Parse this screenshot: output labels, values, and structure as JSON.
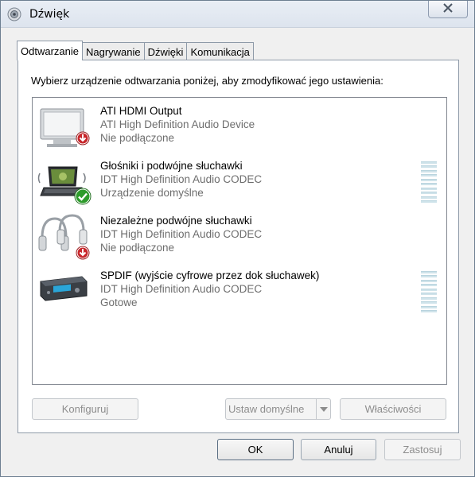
{
  "window": {
    "title": "Dźwięk"
  },
  "tabs": [
    {
      "label": "Odtwarzanie"
    },
    {
      "label": "Nagrywanie"
    },
    {
      "label": "Dźwięki"
    },
    {
      "label": "Komunikacja"
    }
  ],
  "instruction": "Wybierz urządzenie odtwarzania poniżej, aby zmodyfikować jego ustawienia:",
  "devices": [
    {
      "name": "ATI HDMI Output",
      "driver": "ATI High Definition Audio Device",
      "status": "Nie podłączone",
      "icon": "monitor-icon",
      "badge": "disconnected"
    },
    {
      "name": "Głośniki i podwójne słuchawki",
      "driver": "IDT High Definition Audio CODEC",
      "status": "Urządzenie domyślne",
      "icon": "laptop-speakers-icon",
      "badge": "default"
    },
    {
      "name": "Niezależne podwójne słuchawki",
      "driver": "IDT High Definition Audio CODEC",
      "status": "Nie podłączone",
      "icon": "headphones-icon",
      "badge": "disconnected"
    },
    {
      "name": "SPDIF (wyjście cyfrowe przez dok słuchawek)",
      "driver": "IDT High Definition Audio CODEC",
      "status": "Gotowe",
      "icon": "spdif-receiver-icon",
      "badge": "none"
    }
  ],
  "buttons": {
    "configure": "Konfiguruj",
    "set_default": "Ustaw domyślne",
    "properties": "Właściwości",
    "ok": "OK",
    "cancel": "Anuluj",
    "apply": "Zastosuj"
  },
  "colors": {
    "disconnected_badge": "#c8262b",
    "default_badge": "#2d9b2b",
    "meter": "#cfe3ea"
  }
}
